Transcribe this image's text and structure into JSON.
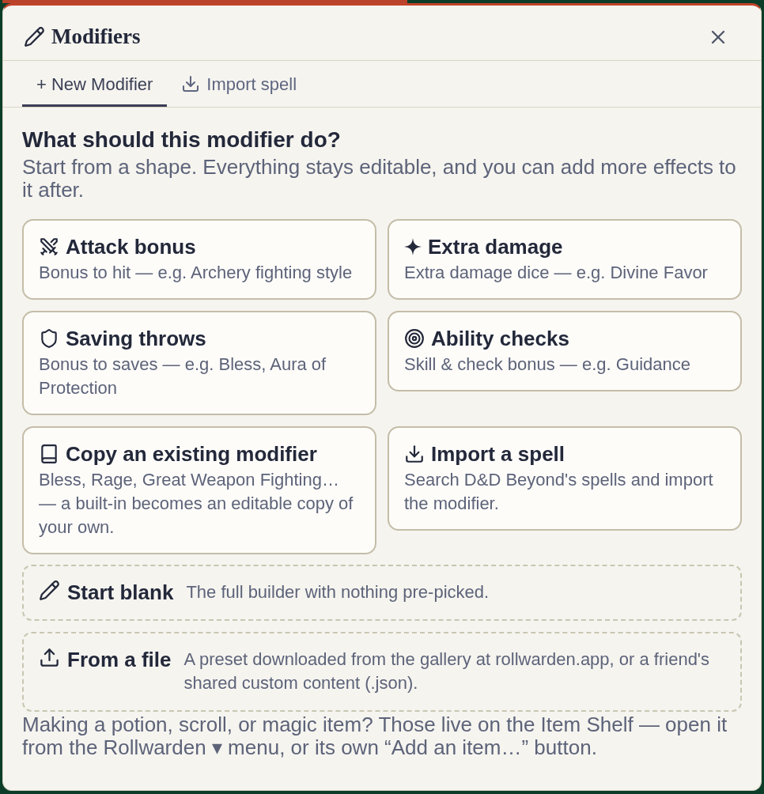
{
  "dialog": {
    "title": "Modifiers"
  },
  "tabs": [
    {
      "label": "+ New Modifier",
      "selected": true
    },
    {
      "label": "Import spell",
      "selected": false
    }
  ],
  "heading": "What should this modifier do?",
  "intro": "Start from a shape. Everything stays editable, and you can add more effects to it after.",
  "options": [
    {
      "title": "Attack bonus",
      "description": "Bonus to hit — e.g. Archery fighting style"
    },
    {
      "title": "Extra damage",
      "description": "Extra damage dice — e.g. Divine Favor"
    },
    {
      "title": "Saving throws",
      "description": "Bonus to saves — e.g. Bless, Aura of Protection"
    },
    {
      "title": "Ability checks",
      "description": "Skill & check bonus — e.g. Guidance"
    },
    {
      "title": "Copy an existing modifier",
      "description": "Bless, Rage, Great Weapon Fighting… — a built-in becomes an editable copy of your own."
    },
    {
      "title": "Import a spell",
      "description": "Search D&D Beyond's spells and import the modifier."
    }
  ],
  "extra_options": [
    {
      "title": "Start blank",
      "description": "The full builder with nothing pre-picked."
    },
    {
      "title": "From a file",
      "description": "A preset downloaded from the gallery at rollwarden.app, or a friend's shared custom content (.json)."
    }
  ],
  "footnote": "Making a potion, scroll, or magic item? Those live on the Item Shelf — open it from the Rollwarden ▾ menu, or its own “Add an item…” button."
}
